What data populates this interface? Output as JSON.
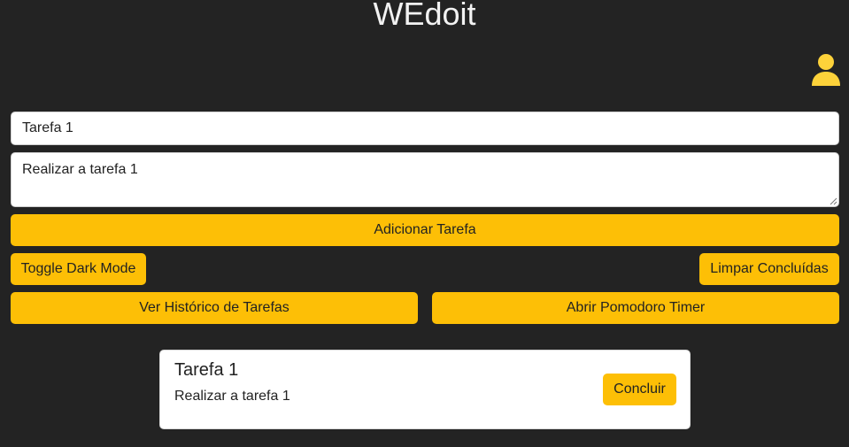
{
  "header": {
    "title": "WEdoit"
  },
  "icons": {
    "user": "user-profile-icon"
  },
  "form": {
    "title_value": "Tarefa 1",
    "description_value": "Realizar a tarefa 1",
    "add_label": "Adicionar Tarefa"
  },
  "actions": {
    "toggle_dark_label": "Toggle Dark Mode",
    "clear_completed_label": "Limpar Concluídas",
    "history_label": "Ver Histórico de Tarefas",
    "pomodoro_label": "Abrir Pomodoro Timer"
  },
  "tasks": [
    {
      "title": "Tarefa 1",
      "description": "Realizar a tarefa 1",
      "complete_label": "Concluir"
    }
  ],
  "colors": {
    "background": "#232323",
    "accent": "#fdbf06",
    "card": "#ffffff",
    "icon": "#fdd23a"
  }
}
